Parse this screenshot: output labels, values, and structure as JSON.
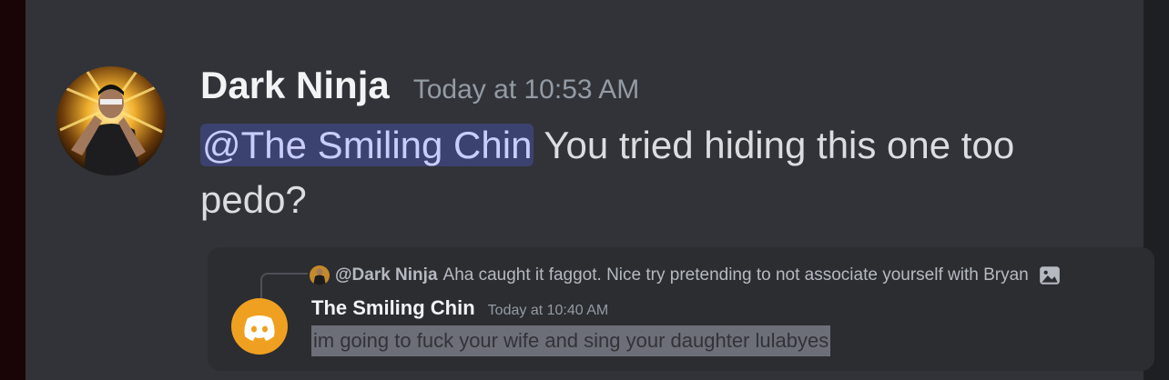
{
  "message": {
    "author": "Dark Ninja",
    "timestamp": "Today at 10:53 AM",
    "mention": "@The Smiling Chin",
    "text": " You tried hiding this one too pedo?"
  },
  "embed": {
    "reply": {
      "author": "@Dark Ninja",
      "text": "Aha caught it faggot. Nice try pretending to not associate yourself with Bryan"
    },
    "author": "The Smiling Chin",
    "timestamp": "Today at 10:40 AM",
    "text": "im going to fuck your wife and sing your daughter lulabyes"
  },
  "colors": {
    "background": "#313338",
    "embed_background": "#2b2d31",
    "mention_bg": "#3c4270",
    "mention_text": "#c9cdfb",
    "discord_avatar": "#f0a020"
  },
  "icons": [
    "ninja-avatar",
    "discord-logo-icon",
    "image-icon"
  ]
}
